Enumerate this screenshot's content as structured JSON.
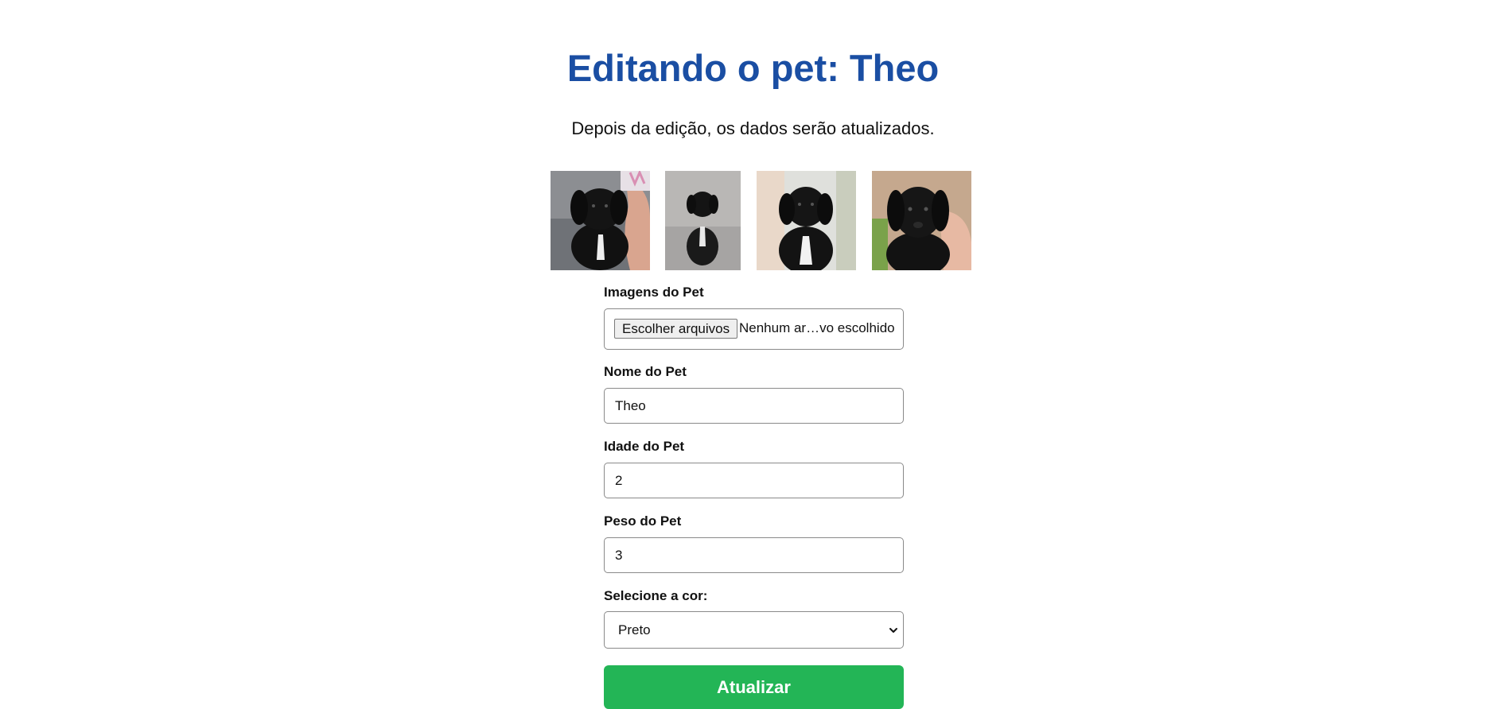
{
  "page": {
    "title": "Editando o pet: Theo",
    "subtitle": "Depois da edição, os dados serão atualizados."
  },
  "gallery": {
    "photos": [
      {
        "icon": "puppy-photo-1"
      },
      {
        "icon": "puppy-photo-2"
      },
      {
        "icon": "puppy-photo-3"
      },
      {
        "icon": "puppy-photo-4"
      }
    ]
  },
  "form": {
    "images": {
      "label": "Imagens do Pet",
      "button_label": "Escolher arquivos",
      "status": "Nenhum ar…vo escolhido"
    },
    "name": {
      "label": "Nome do Pet",
      "value": "Theo"
    },
    "age": {
      "label": "Idade do Pet",
      "value": "2"
    },
    "weight": {
      "label": "Peso do Pet",
      "value": "3"
    },
    "color": {
      "label": "Selecione a cor:",
      "selected": "Preto"
    },
    "submit_label": "Atualizar"
  },
  "colors": {
    "title": "#1a4ea3",
    "submit": "#23b556"
  }
}
